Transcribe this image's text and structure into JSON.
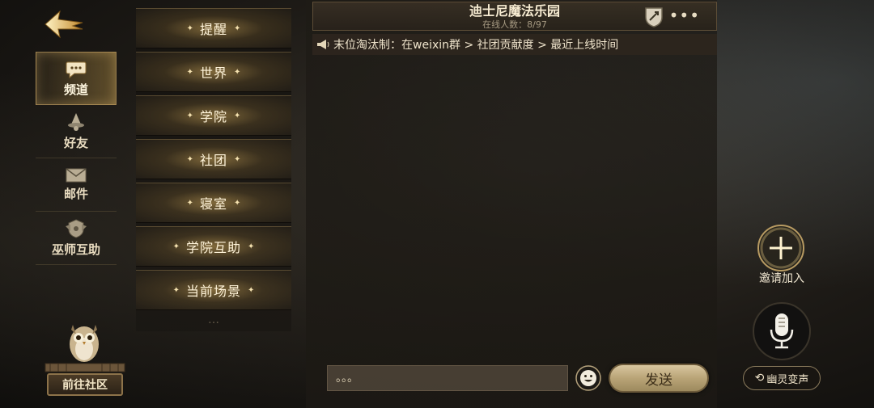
{
  "nav": {
    "items": [
      {
        "label": "频道",
        "icon": "chat-bubble-icon",
        "active": true
      },
      {
        "label": "好友",
        "icon": "wizard-hat-icon",
        "active": false
      },
      {
        "label": "邮件",
        "icon": "envelope-icon",
        "active": false
      },
      {
        "label": "巫师互助",
        "icon": "crest-icon",
        "active": false
      }
    ],
    "community_label": "前往社区"
  },
  "channels": {
    "items": [
      "提醒",
      "世界",
      "学院",
      "社团",
      "寝室",
      "学院互助",
      "当前场景"
    ],
    "partial": "…"
  },
  "chat": {
    "title": "迪士尼魔法乐园",
    "online": "在线人数：8/97",
    "more": "•••",
    "notice": "末位淘汰制：在weixin群 > 社团贡献度 > 最近上线时间",
    "input_placeholder": "。。。",
    "send_label": "发送"
  },
  "side": {
    "invite_label": "邀请加入",
    "voice_label": "幽灵变声"
  },
  "colors": {
    "accent_gold": "#d9b56a",
    "text_cream": "#f1e6cc",
    "panel_dark": "#1d1a16"
  }
}
